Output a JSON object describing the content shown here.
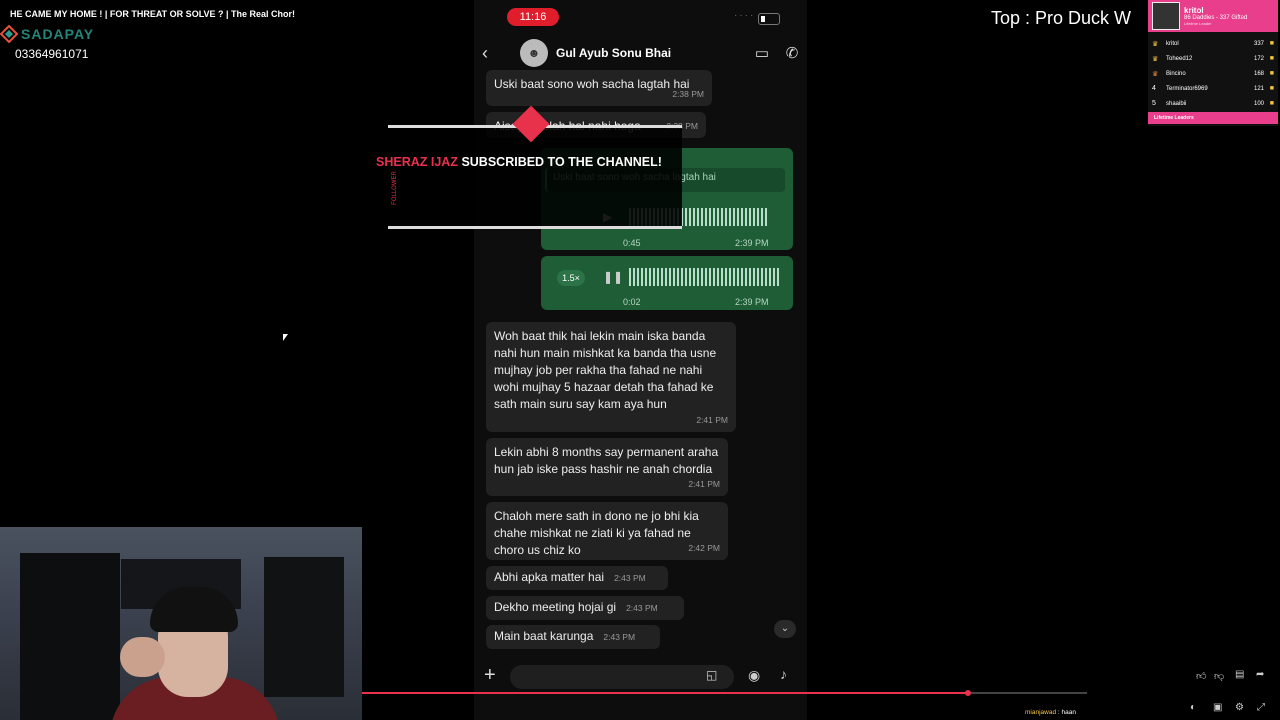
{
  "stream": {
    "title": "HE CAME MY HOME ! | FOR THREAT OR SOLVE ? | The Real Chor!",
    "sponsor_name": "SADAPAY",
    "phone": "03364961071",
    "top_banner": "Top : Pro Duck W"
  },
  "leaderboard": {
    "top_name": "kritol",
    "top_sub": "86 Daddies - 337 Gifted",
    "top_sub2": "Lifetime Leader",
    "rows": [
      {
        "rank": "",
        "name": "kritol",
        "score": "337"
      },
      {
        "rank": "",
        "name": "Toheed12",
        "score": "172"
      },
      {
        "rank": "",
        "name": "Bincino",
        "score": "168"
      },
      {
        "rank": "4",
        "name": "Terminator6969",
        "score": "121"
      },
      {
        "rank": "5",
        "name": "shaaibii",
        "score": "100"
      }
    ],
    "footer": "Lifetime Leaders"
  },
  "phone": {
    "clock": "11:16",
    "contact": "Gul Ayub Sonu Bhai"
  },
  "messages": {
    "m1": {
      "text": "Uski baat sono woh sacha lagtah hai",
      "time": "2:38 PM"
    },
    "m2": {
      "text": "Aisay maslah hal nahi hoga",
      "time": "2:38 PM"
    },
    "v1": {
      "quote": "Uski baat sono woh sacha lagtah hai",
      "dur": "0:45",
      "time": "2:39 PM"
    },
    "v2": {
      "speed": "1.5×",
      "dur": "0:02",
      "time": "2:39 PM"
    },
    "m3": {
      "text": "Woh baat thik hai lekin main iska banda nahi hun main mishkat ka banda tha usne mujhay job per rakha tha fahad ne nahi wohi mujhay 5 hazaar detah tha fahad ke sath main suru say kam aya hun",
      "time": "2:41 PM"
    },
    "m4": {
      "text": "Lekin abhi 8 months say permanent araha hun jab iske pass hashir ne anah chordia",
      "time": "2:41 PM"
    },
    "m5": {
      "text": "Chaloh mere sath in dono ne jo bhi kia chahe mishkat ne ziati ki ya fahad ne choro us chiz ko",
      "time": "2:42 PM"
    },
    "m6": {
      "text": "Abhi apka matter hai",
      "time": "2:43 PM"
    },
    "m7": {
      "text": "Dekho meeting hojai gi",
      "time": "2:43 PM"
    },
    "m8": {
      "text": "Main baat karunga",
      "time": "2:43 PM"
    }
  },
  "alert": {
    "name": "SHERAZ IJAZ",
    "text": "SUBSCRIBED TO THE CHANNEL!",
    "vertical": "FOLLOWER"
  },
  "chat_line": {
    "user": "mianjawad",
    "text": ": haan"
  },
  "progress": {
    "played_fraction": 0.836
  }
}
